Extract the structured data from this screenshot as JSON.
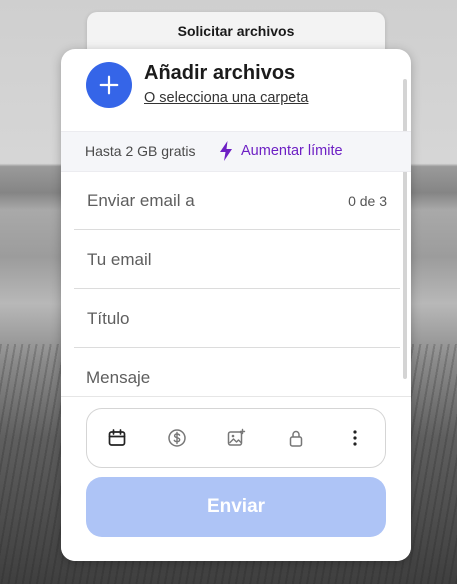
{
  "back_tab": {
    "label": "Solicitar archivos"
  },
  "upload": {
    "title": "Añadir archivos",
    "folder_link": "O selecciona una carpeta"
  },
  "limit": {
    "text": "Hasta 2 GB gratis",
    "upgrade_label": "Aumentar límite",
    "accent_color": "#6d1fc4"
  },
  "form": {
    "recipient_placeholder": "Enviar email a",
    "recipient_counter": "0 de 3",
    "email_placeholder": "Tu email",
    "title_placeholder": "Título",
    "message_placeholder": "Mensaje"
  },
  "toolbar": {
    "icons": [
      "calendar-icon",
      "dollar-icon",
      "image-icon",
      "lock-icon",
      "more-icon"
    ]
  },
  "send": {
    "label": "Enviar",
    "color": "#aec4f6"
  },
  "colors": {
    "primary": "#3565e8"
  }
}
